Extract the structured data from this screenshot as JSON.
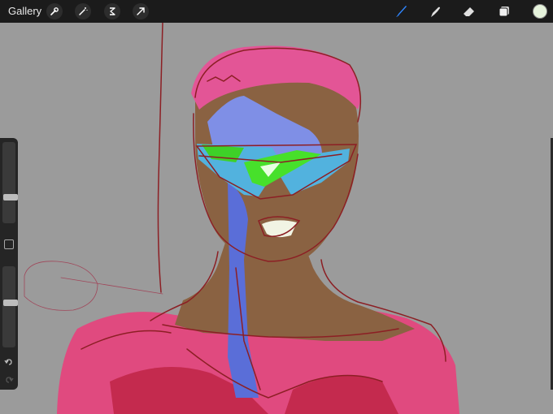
{
  "topbar": {
    "gallery_label": "Gallery",
    "left_tools": [
      "wrench-icon",
      "magic-wand-icon",
      "selection-icon",
      "transform-arrow-icon"
    ],
    "right_tools": [
      "brush-icon",
      "smudge-icon",
      "eraser-icon",
      "layers-icon"
    ],
    "active_tool": "brush-icon",
    "active_color": "#e6f3dc",
    "accent": "#2f86ff"
  },
  "sidebar": {
    "brush_size_level": 0.7,
    "opacity_level": 0.45,
    "icons": [
      "modify-square-icon",
      "undo-icon",
      "redo-icon"
    ]
  },
  "canvas": {
    "background": "#9b9b9b"
  }
}
